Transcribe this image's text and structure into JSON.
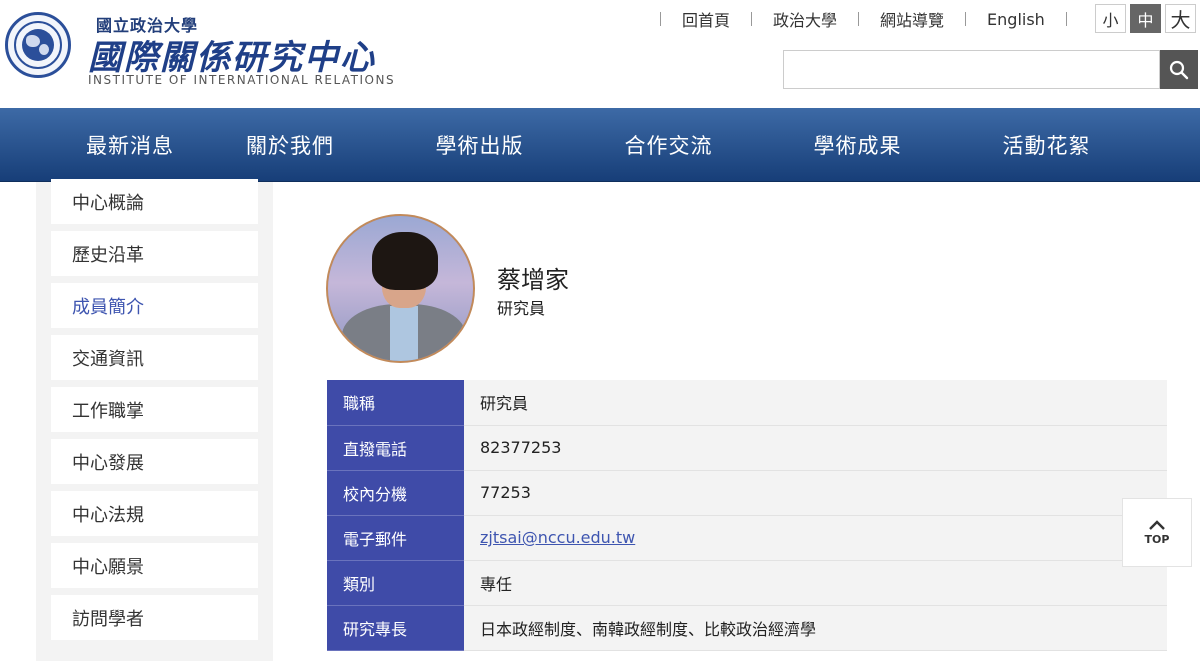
{
  "header": {
    "logo_small": "國立政治大學",
    "logo_title": "國際關係研究中心",
    "logo_english": "INSTITUTE OF INTERNATIONAL RELATIONS"
  },
  "toplinks": [
    "回首頁",
    "政治大學",
    "網站導覽",
    "English"
  ],
  "font_size": {
    "small": "小",
    "medium": "中",
    "large": "大",
    "selected": "中"
  },
  "search": {
    "placeholder": "",
    "icon": "search-icon"
  },
  "nav": [
    "最新消息",
    "關於我們",
    "學術出版",
    "合作交流",
    "學術成果",
    "活動花絮"
  ],
  "sidebar": {
    "items": [
      "中心概論",
      "歷史沿革",
      "成員簡介",
      "交通資訊",
      "工作職掌",
      "中心發展",
      "中心法規",
      "中心願景",
      "訪問學者"
    ],
    "active": "成員簡介"
  },
  "profile": {
    "name": "蔡增家",
    "title": "研究員",
    "rows": [
      {
        "key": "職稱",
        "value": "研究員"
      },
      {
        "key": "直撥電話",
        "value": "82377253"
      },
      {
        "key": "校內分機",
        "value": "77253"
      },
      {
        "key": "電子郵件",
        "value": "zjtsai@nccu.edu.tw"
      },
      {
        "key": "類別",
        "value": "專任"
      },
      {
        "key": "研究專長",
        "value": "日本政經制度、南韓政經制度、比較政治經濟學"
      }
    ]
  },
  "top_button": {
    "label": "TOP"
  },
  "colors": {
    "nav_top": "#3d6aa6",
    "nav_bottom": "#173e78",
    "table_key_bg": "#3f4ba8",
    "accent_link": "#3e55b0"
  }
}
